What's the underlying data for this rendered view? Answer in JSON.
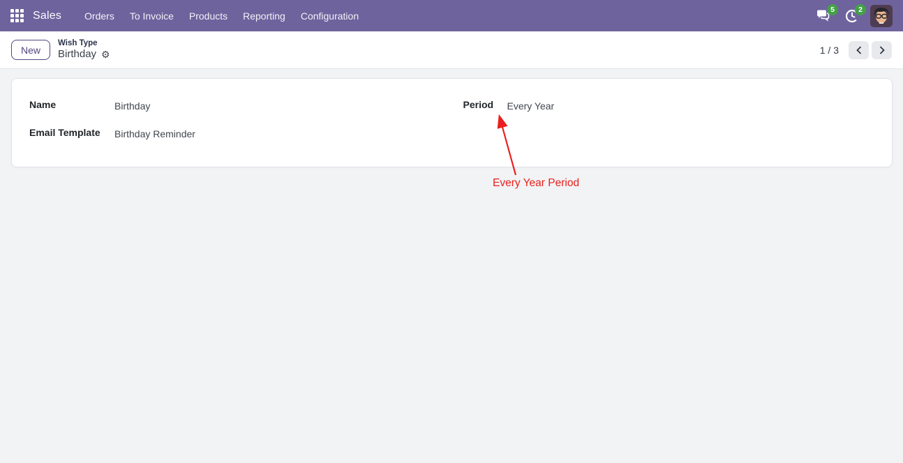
{
  "navbar": {
    "app_name": "Sales",
    "menu_items": [
      "Orders",
      "To Invoice",
      "Products",
      "Reporting",
      "Configuration"
    ],
    "messages_badge": "5",
    "activities_badge": "2"
  },
  "control_panel": {
    "new_button_label": "New",
    "breadcrumb_parent": "Wish Type",
    "breadcrumb_current": "Birthday",
    "gear_glyph": "⚙",
    "pager_text": "1 / 3"
  },
  "form": {
    "fields": [
      {
        "label": "Name",
        "value": "Birthday"
      },
      {
        "label": "Email Template",
        "value": "Birthday Reminder"
      },
      {
        "label": "Period",
        "value": "Every Year"
      }
    ]
  },
  "annotation": {
    "label": "Every Year Period"
  },
  "colors": {
    "navbar_bg": "#6e639d",
    "badge_green": "#43a047",
    "primary_purple": "#54457f",
    "annotation_red": "#e9201d",
    "content_bg": "#f2f3f5"
  }
}
